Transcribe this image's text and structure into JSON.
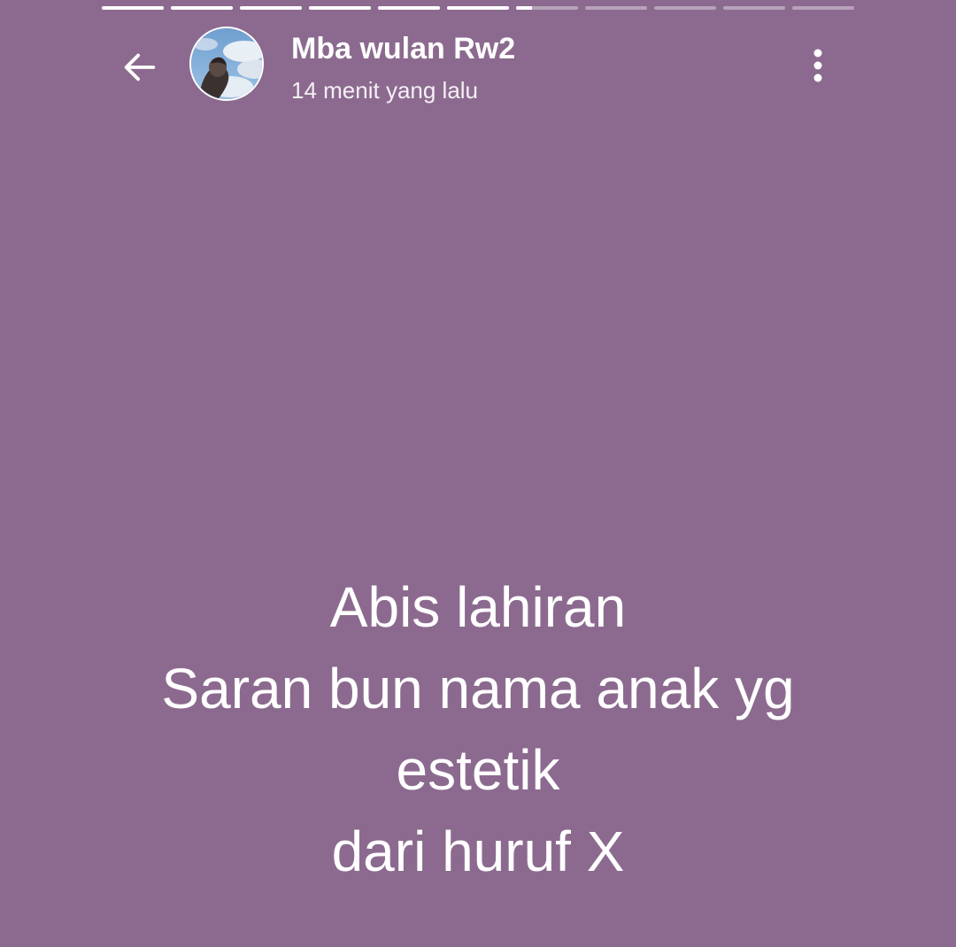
{
  "theme": {
    "background": "#8c6a8f",
    "text_color": "#ffffff"
  },
  "progress": {
    "segments_total": 11,
    "segments_viewed": 6,
    "current_segment_fraction": 0.25
  },
  "header": {
    "back_icon": "arrow-left-icon",
    "contact_name": "Mba wulan Rw2",
    "timestamp": "14 menit yang lalu",
    "menu_icon": "more-vertical-icon"
  },
  "status": {
    "lines": [
      "Abis lahiran",
      "Saran bun nama anak yg",
      "estetik",
      "dari huruf X"
    ]
  }
}
